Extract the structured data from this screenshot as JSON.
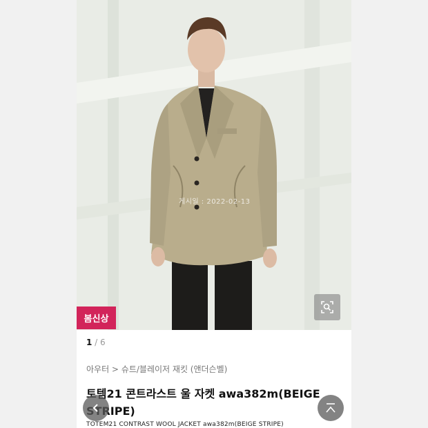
{
  "product": {
    "badge": "봄신상",
    "watermark": "게시일 : 2022-02-13",
    "pager": {
      "current": "1",
      "separator": " / ",
      "total": "6"
    },
    "breadcrumb": "아우터 > 슈트/블레이저 재킷 (앤더슨벨)",
    "title": "토템21 콘트라스트 울 자켓 awa382m(BEIGE STRIPE)",
    "subtitle": "TOTEM21 CONTRAST WOOL JACKET awa382m(BEIGE STRIPE)"
  },
  "icons": {
    "zoom": "zoom-icon",
    "back": "arrow-left-icon",
    "top": "scroll-to-top-icon"
  },
  "colors": {
    "badge": "#d2245a",
    "jacket": "#b9ad8c"
  }
}
